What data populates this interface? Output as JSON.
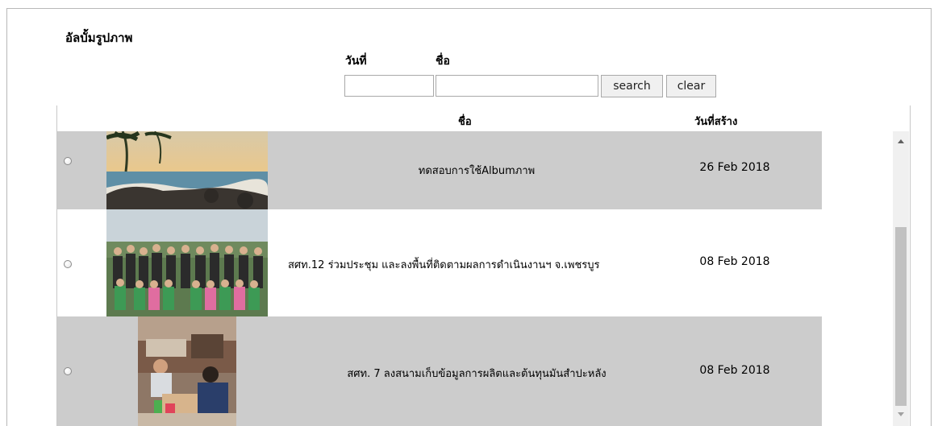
{
  "page": {
    "title": "อัลบั้มรูปภาพ"
  },
  "filters": {
    "date_label": "วันที่",
    "name_label": "ชื่อ",
    "date_value": "",
    "name_value": "",
    "search_label": "search",
    "clear_label": "clear"
  },
  "table": {
    "columns": {
      "name": "ชื่อ",
      "created": "วันที่สร้าง"
    },
    "rows": [
      {
        "name": "ทดสอบการใช้Albumภาพ",
        "date": "26 Feb 2018",
        "thumb_icon": "beach-photo"
      },
      {
        "name": "สศท.12 ร่วมประชุม และลงพื้นที่ติดตามผลการดำเนินงานฯ จ.เพชรบูร",
        "date": "08 Feb 2018",
        "thumb_icon": "group-photo"
      },
      {
        "name": "สศท. 7 ลงสนามเก็บข้อมูลการผลิตและต้นทุนมันสำปะหลัง",
        "date": "08 Feb 2018",
        "thumb_icon": "interview-photo"
      }
    ]
  },
  "colors": {
    "row_gray": "#cccccc",
    "row_white": "#ffffff",
    "scroll_thumb": "#c1c1c1"
  }
}
